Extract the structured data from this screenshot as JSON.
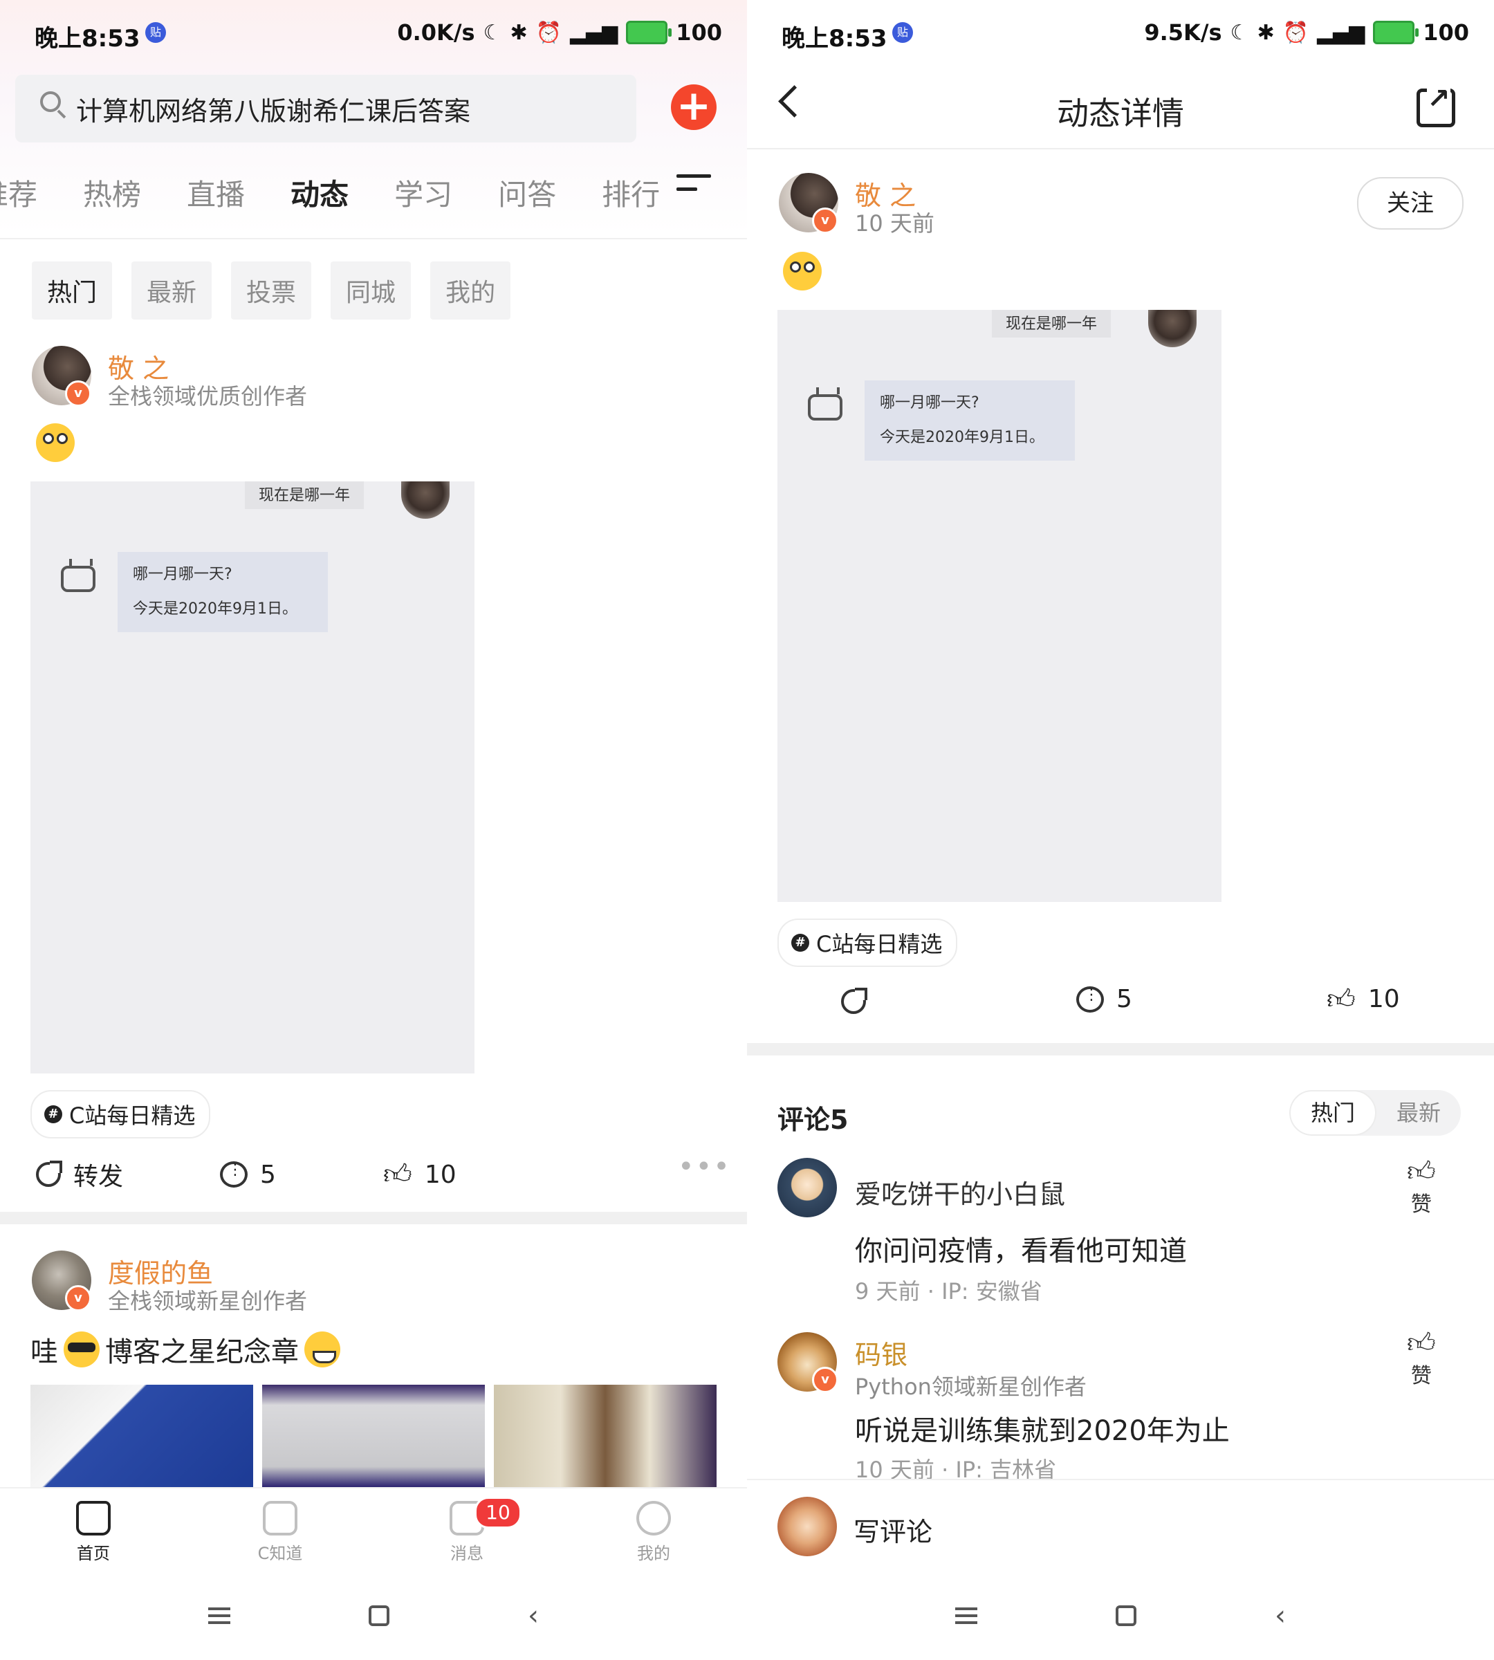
{
  "left": {
    "status": {
      "time": "晚上8:53",
      "badge": "贴",
      "speed": "0.0K/s",
      "battery": "100"
    },
    "search": {
      "query": "计算机网络第八版谢希仁课后答案"
    },
    "add_icon": "plus-icon",
    "tabs": [
      "推荐",
      "热榜",
      "直播",
      "动态",
      "学习",
      "问答",
      "排行"
    ],
    "chips": [
      "热门",
      "最新",
      "投票",
      "同城",
      "我的"
    ],
    "post1": {
      "author": "敬 之",
      "subtitle": "全栈领域优质创作者",
      "screenshot": {
        "top_bubble": "现在是哪一年",
        "question": "哪一月哪一天?",
        "answer": "今天是2020年9月1日。"
      },
      "topic": "C站每日精选",
      "repost_label": "转发",
      "comments": "5",
      "likes": "10"
    },
    "post2": {
      "author": "度假的鱼",
      "subtitle": "全栈领域新星创作者",
      "text_a": "哇",
      "text_b": "博客之星纪念章"
    },
    "bottom_nav": [
      {
        "label": "首页",
        "icon": "home-icon"
      },
      {
        "label": "C知道",
        "icon": "robot-icon"
      },
      {
        "label": "消息",
        "icon": "message-icon",
        "badge": "10"
      },
      {
        "label": "我的",
        "icon": "profile-icon"
      }
    ]
  },
  "right": {
    "status": {
      "time": "晚上8:53",
      "badge": "贴",
      "speed": "9.5K/s",
      "battery": "100"
    },
    "title": "动态详情",
    "author": "敬 之",
    "time_ago": "10 天前",
    "follow_label": "关注",
    "screenshot": {
      "top_bubble": "现在是哪一年",
      "question": "哪一月哪一天?",
      "answer": "今天是2020年9月1日。"
    },
    "topic": "C站每日精选",
    "comments": "5",
    "likes": "10",
    "comments_header": "评论5",
    "sort": [
      "热门",
      "最新"
    ],
    "comment_list": [
      {
        "name": "爱吃饼干的小白鼠",
        "text": "你问问疫情，看看他可知道",
        "time": "9 天前",
        "ip": "IP: 安徽省",
        "like_label": "赞"
      },
      {
        "name": "码银",
        "subtitle": "Python领域新星创作者",
        "text": "听说是训练集就到2020年为止",
        "time": "10 天前",
        "ip": "IP: 吉林省",
        "like_label": "赞"
      }
    ],
    "write_comment": "写评论"
  },
  "colors": {
    "accent": "#f4462c",
    "author_orange": "#e88a3c",
    "gold_name": "#c9902a",
    "badge_red": "#f03a3a"
  }
}
